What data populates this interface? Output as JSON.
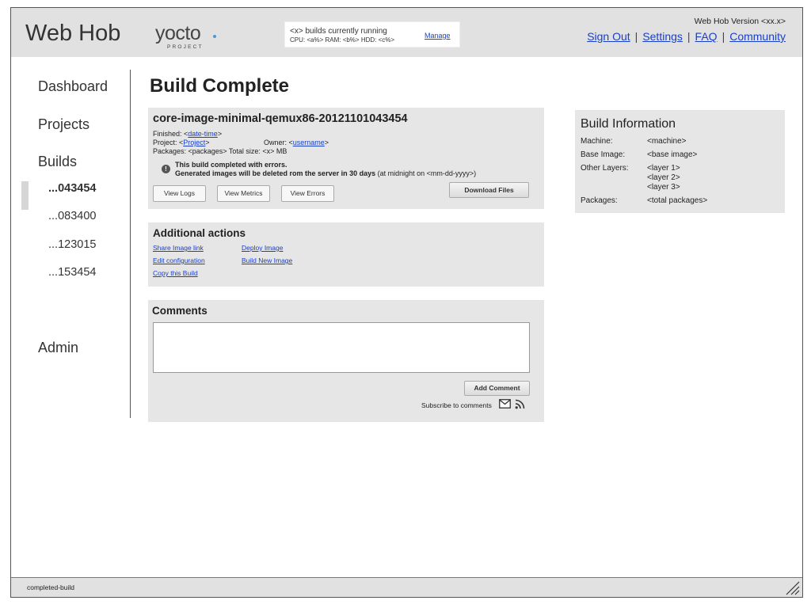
{
  "header": {
    "app_title": "Web Hob",
    "logo_text": "yocto",
    "logo_sub": "PROJECT",
    "status_running": "<x> builds currently running",
    "status_stats": "CPU: <a%>   RAM: <b%>   HDD: <c%>",
    "manage_label": "Manage",
    "version": "Web Hob Version <xx.x>",
    "links": {
      "sign_out": "Sign Out",
      "settings": "Settings",
      "faq": "FAQ",
      "community": "Community",
      "separator": "|"
    }
  },
  "sidebar": {
    "dashboard": "Dashboard",
    "projects": "Projects",
    "builds": "Builds",
    "build_items": [
      "...043454",
      "...083400",
      "...123015",
      "...153454"
    ],
    "admin": "Admin"
  },
  "main": {
    "page_title": "Build Complete",
    "build": {
      "name": "core-image-minimal-qemux86-20121101043454",
      "finished_label": "Finished: <",
      "finished_value": "date-time",
      "finished_tail": ">",
      "project_label": "Project: <",
      "project_value": "Project",
      "project_tail": ">",
      "owner_label": "Owner: <",
      "owner_value": "username",
      "owner_tail": ">",
      "packages": "Packages: <packages>   Total size: <x> MB",
      "warning_line1": "This build completed with errors.",
      "warning_line2_bold": "Generated images will be deleted rom the server in 30 days",
      "warning_line2_rest": " (at midnight on <mm-dd-yyyy>)",
      "buttons": {
        "view_logs": "View Logs",
        "view_metrics": "View Metrics",
        "view_errors": "View Errors",
        "download_files": "Download Files"
      }
    },
    "info": {
      "title": "Build Information",
      "machine_label": "Machine:",
      "machine_value": "<machine>",
      "base_image_label": "Base Image:",
      "base_image_value": "<base image>",
      "other_layers_label": "Other Layers:",
      "layers": [
        "<layer 1>",
        "<layer 2>",
        "<layer 3>"
      ],
      "packages_label": "Packages:",
      "packages_value": "<total packages>"
    },
    "actions": {
      "title": "Additional actions",
      "share_image_link": "Share Image link",
      "edit_configuration": "Edit configuration",
      "copy_this_build": "Copy this Build",
      "deploy_image": "Deploy Image",
      "build_new_image": "Build New Image"
    },
    "comments": {
      "title": "Comments",
      "input_value": "",
      "add_comment": "Add Comment",
      "subscribe": "Subscribe to comments"
    }
  },
  "footer": {
    "label": "completed-build"
  },
  "icons": {
    "warning": "warning-icon",
    "mail": "mail-icon",
    "rss": "rss-icon",
    "resize": "resize-grip-icon"
  },
  "colors": {
    "header_bg": "#e1e1e1",
    "panel_bg": "#e6e6e6",
    "link": "#1a3fc7",
    "logo_accent": "#4a9ad8"
  }
}
